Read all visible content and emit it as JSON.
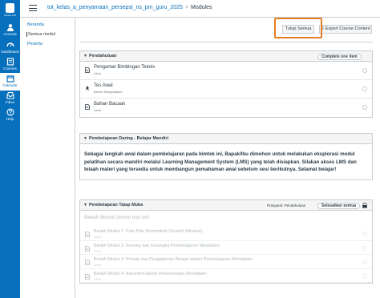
{
  "global_nav": {
    "logo_text": "Tanoto ICO",
    "items": [
      {
        "label": "Account",
        "icon": "account-icon"
      },
      {
        "label": "Dashboard",
        "icon": "dashboard-icon"
      },
      {
        "label": "Courses",
        "icon": "courses-icon"
      },
      {
        "label": "Calendar",
        "icon": "calendar-icon"
      },
      {
        "label": "Inbox",
        "icon": "inbox-icon"
      },
      {
        "label": "Help",
        "icon": "help-icon"
      }
    ]
  },
  "breadcrumb": {
    "course": "tot_kelas_a_penyamaan_persepsi_ns_pm_guru_2025",
    "separator": ">",
    "current": "Modules"
  },
  "course_nav": {
    "items": [
      {
        "label": "Beranda"
      },
      {
        "label": "Semua modul"
      },
      {
        "label": "Peserta"
      }
    ]
  },
  "toolbar": {
    "collapse_label": "Tutup Semua",
    "export_label": "Export Course Content"
  },
  "modules": {
    "pendahuluan": {
      "title": "Pendahuluan",
      "status": "Complete one item",
      "items": [
        {
          "title": "Pengantar Bimbingan Teknis",
          "sub": "Lihat"
        },
        {
          "title": "Tes Awal",
          "sub": "Belum Mengerjakan"
        },
        {
          "title": "Bahan Bacaan",
          "sub": "Lihat"
        }
      ]
    },
    "daring": {
      "title": "Pembelajaran Daring - Belajar Mandiri",
      "body": "Sebagai langkah awal dalam pembelajaran pada bimtek ini, Bapak/Ibu dimohon untuk melakukan eksplorasi modul pelatihan secara mandiri melalui Learning Management System (LMS) yang telah disiapkan. Silakan akses LMS dan telaah materi yang tersedia untuk membangun pemahaman awal sebelum sesi berikutnya. Selamat belajar!"
    },
    "tatap_muka": {
      "title": "Pembelajaran Tatap Muka",
      "prereq": "Prasyarat: Pendahuluan",
      "status": "Selesaikan semua",
      "subheader": "Bedah Modul Umum dan Inti",
      "items": [
        {
          "title": "Bedah Modul 1: Pola Pikir Bertumbuh (Growth Mindset)",
          "sub": "Lihat"
        },
        {
          "title": "Bedah Modul 2: Konsep dan Kerangka Pembelajaran Mendalam",
          "sub": "Lihat"
        },
        {
          "title": "Bedah Modul 3: Prinsip dan Pengalaman Belajar dalam Pembelajaran Mendalam",
          "sub": "Lihat"
        },
        {
          "title": "Bedah Modul 4: Asesmen dalam Perencanaan Mendalam",
          "sub": "Lihat"
        }
      ]
    }
  },
  "colors": {
    "nav_blue": "#0770bd",
    "highlight_orange": "#e67e22",
    "border": "#c7cdd1"
  }
}
